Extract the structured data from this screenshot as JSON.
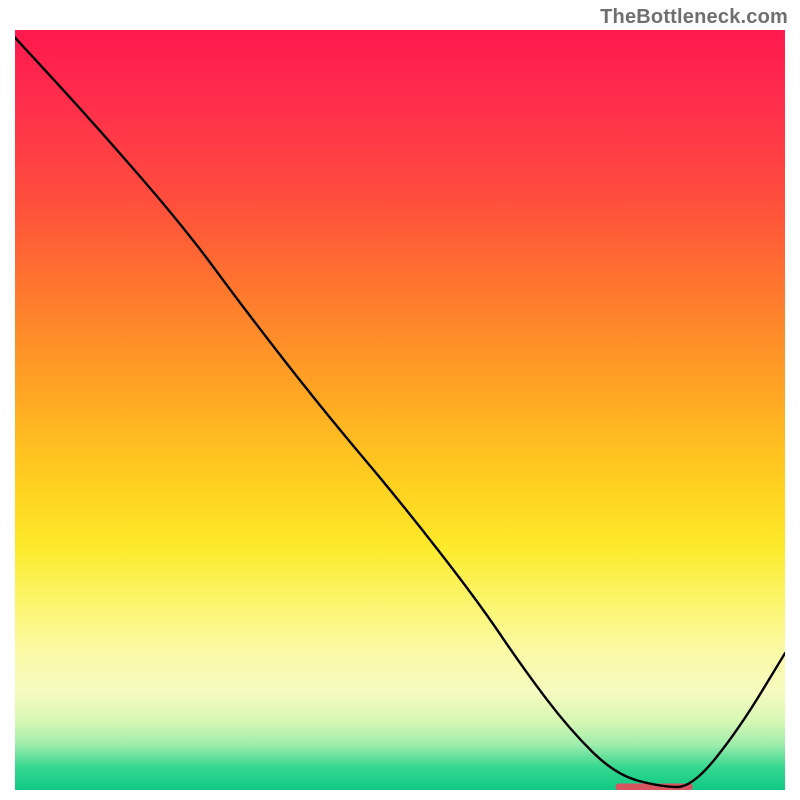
{
  "watermark": "TheBottleneck.com",
  "colors": {
    "gradient_top": "#ff1a4d",
    "gradient_bottom": "#10c985",
    "curve": "#000000",
    "plateau_marker": "#d6555f",
    "watermark_text": "#6f6f6f"
  },
  "chart_data": {
    "type": "line",
    "title": "",
    "xlabel": "",
    "ylabel": "",
    "xlim": [
      0,
      100
    ],
    "ylim": [
      0,
      100
    ],
    "grid": false,
    "legend": false,
    "series": [
      {
        "name": "curve",
        "x": [
          0,
          10,
          22,
          30,
          40,
          50,
          60,
          66,
          72,
          78,
          84,
          88,
          94,
          100
        ],
        "y": [
          99,
          88,
          74,
          63,
          50,
          38,
          25,
          16,
          8,
          2,
          0.4,
          0.4,
          8,
          18
        ]
      }
    ],
    "annotations": [
      {
        "name": "plateau_marker",
        "x_range": [
          78,
          88
        ],
        "y": 0.4
      }
    ]
  }
}
